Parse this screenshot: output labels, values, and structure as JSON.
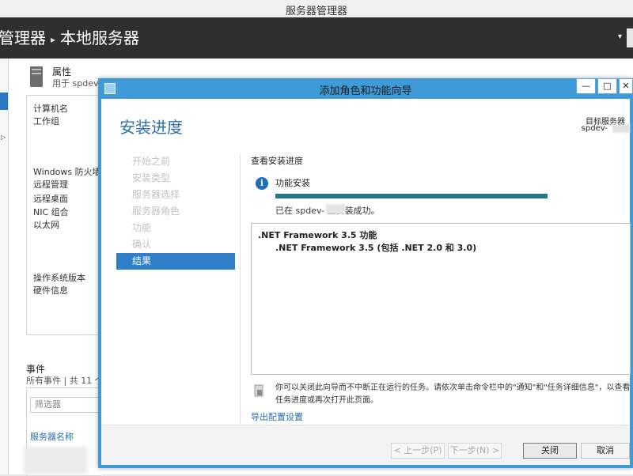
{
  "window": {
    "title": "服务器管理器"
  },
  "header": {
    "breadcrumb_root": "管理器",
    "breadcrumb_sep": "▸",
    "breadcrumb_page": "本地服务器",
    "refresh_icon": "▾"
  },
  "properties": {
    "title": "属性",
    "subtitle": "用于 spdev-",
    "labels": [
      "计算机名",
      "工作组",
      "Windows 防火墙",
      "远程管理",
      "远程桌面",
      "NIC 组合",
      "以太网",
      "操作系统版本",
      "硬件信息"
    ]
  },
  "events": {
    "title": "事件",
    "subtitle": "所有事件 | 共 11 个",
    "filter_placeholder": "筛选器",
    "column_header": "服务器名称"
  },
  "wizard": {
    "title": "添加角色和功能向导",
    "heading": "安装进度",
    "target_label": "目标服务器",
    "target_value": "spdev-",
    "buttons": {
      "minimize": "—",
      "maximize": "□",
      "close": "✕"
    },
    "steps": [
      {
        "label": "开始之前",
        "active": false
      },
      {
        "label": "安装类型",
        "active": false
      },
      {
        "label": "服务器选择",
        "active": false
      },
      {
        "label": "服务器角色",
        "active": false
      },
      {
        "label": "功能",
        "active": false
      },
      {
        "label": "确认",
        "active": false
      },
      {
        "label": "结果",
        "active": true
      }
    ],
    "view_progress_label": "查看安装进度",
    "feature_install_label": "功能安装",
    "progress_percent": 100,
    "status_text": "已在 spdev-     上安装成功。",
    "results": {
      "feature_main": ".NET Framework 3.5 功能",
      "feature_child": ".NET Framework 3.5 (包括 .NET 2.0 和 3.0)"
    },
    "note": "你可以关闭此向导而不中断正在运行的任务。请依次单击命令栏中的\"通知\"和\"任务详细信息\"，以查看任务进度或再次打开此页面。",
    "export_link": "导出配置设置",
    "footer": {
      "prev": "< 上一步(P)",
      "next": "下一步(N) >",
      "close": "关闭",
      "cancel": "取消"
    }
  },
  "colors": {
    "accent": "#2e7fc8",
    "titlebar": "#3e9bd8",
    "progress": "#25758f"
  }
}
